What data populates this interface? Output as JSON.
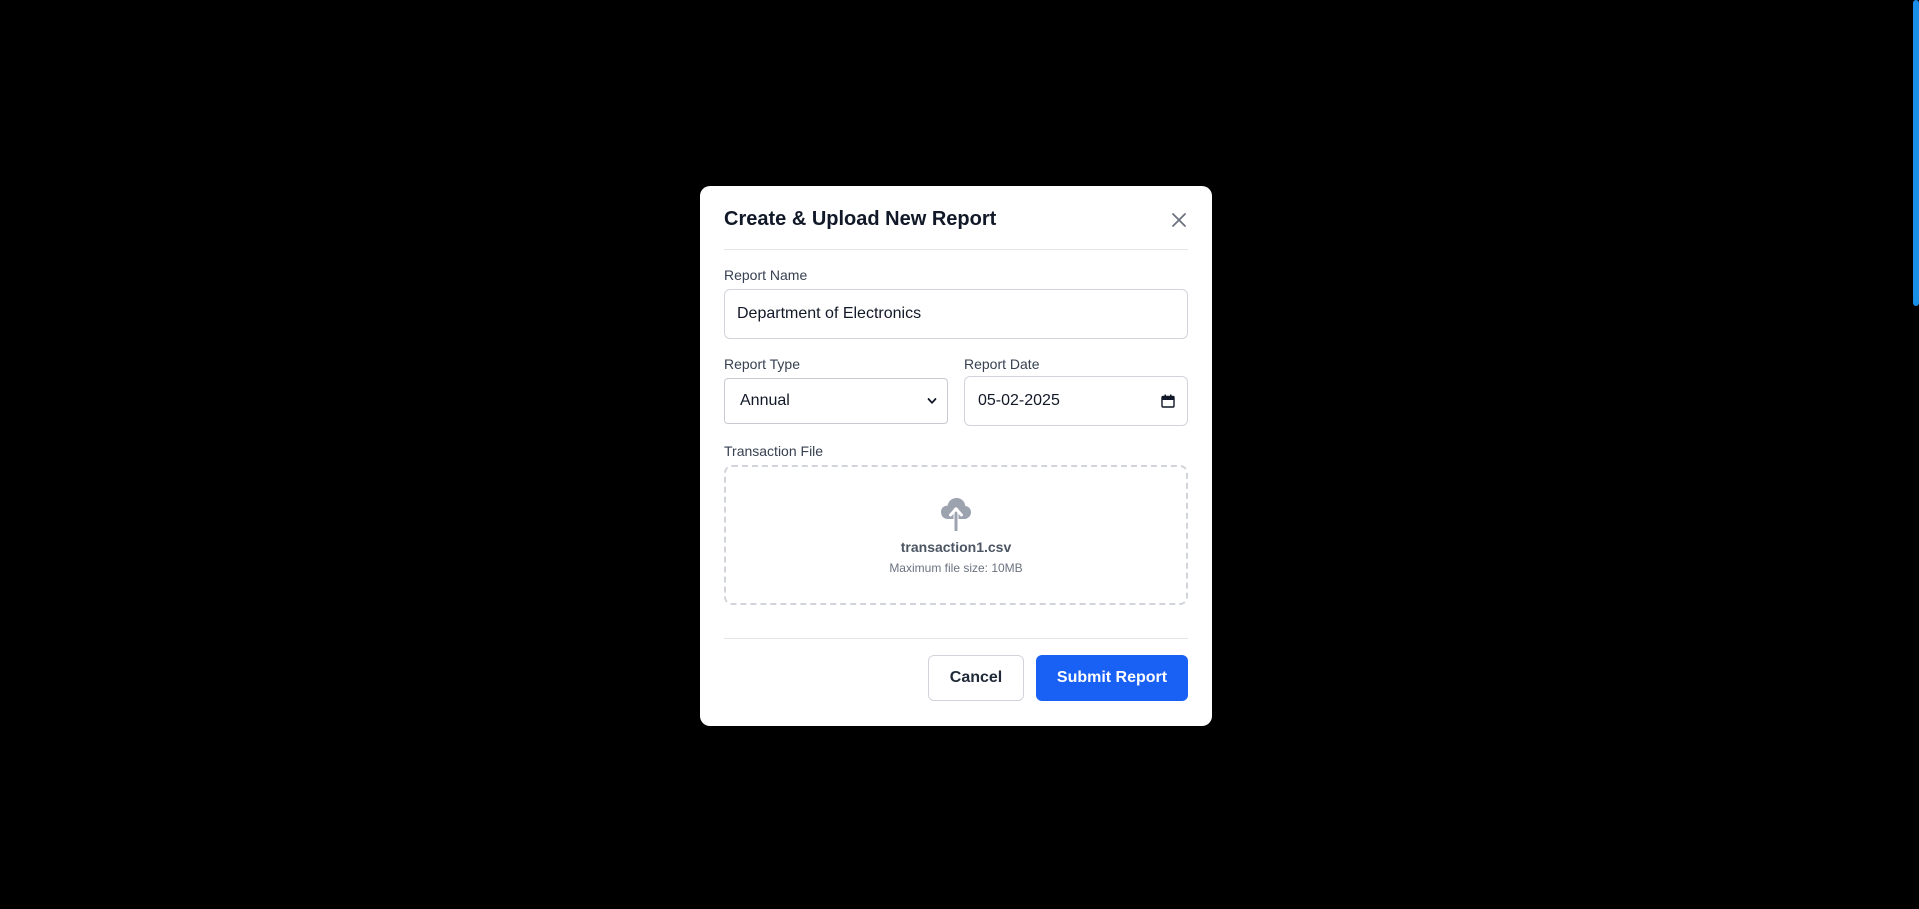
{
  "modal": {
    "title": "Create & Upload New Report"
  },
  "form": {
    "report_name": {
      "label": "Report Name",
      "value": "Department of Electronics"
    },
    "report_type": {
      "label": "Report Type",
      "selected": "Annual"
    },
    "report_date": {
      "label": "Report Date",
      "value": "05-02-2025"
    },
    "transaction_file": {
      "label": "Transaction File",
      "file_name": "transaction1.csv",
      "hint": "Maximum file size: 10MB"
    }
  },
  "footer": {
    "cancel_label": "Cancel",
    "submit_label": "Submit Report"
  },
  "icons": {
    "close": "close-icon",
    "chevron": "chevron-down-icon",
    "calendar": "calendar-icon",
    "upload": "cloud-upload-icon"
  },
  "colors": {
    "primary": "#1960f5",
    "backdrop": "#000000",
    "scrollbar": "#1a8fe8"
  }
}
